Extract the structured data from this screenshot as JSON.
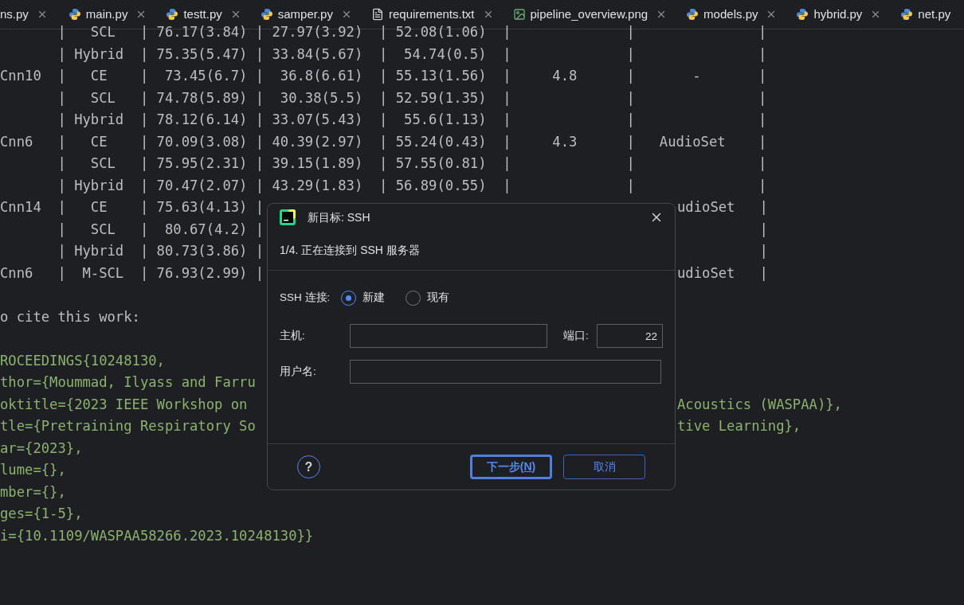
{
  "tabs": [
    {
      "label": "ns.py",
      "kind": "cut",
      "close": true
    },
    {
      "label": "main.py",
      "kind": "python",
      "close": true
    },
    {
      "label": "testt.py",
      "kind": "python",
      "close": true
    },
    {
      "label": "samper.py",
      "kind": "python",
      "close": true
    },
    {
      "label": "requirements.txt",
      "kind": "text",
      "close": true
    },
    {
      "label": "pipeline_overview.png",
      "kind": "image",
      "close": true
    },
    {
      "label": "models.py",
      "kind": "python",
      "close": true
    },
    {
      "label": "hybrid.py",
      "kind": "python",
      "close": true
    },
    {
      "label": "net.py",
      "kind": "python",
      "close": false
    }
  ],
  "editor": {
    "lines": [
      {
        "kind": "plain",
        "left": "       |   SCL   | 76.17(3.84) | 27.97(3.92)  | 52.08(1.06)  |              |               |"
      },
      {
        "kind": "plain",
        "left": "       | Hybrid  | 75.35(5.47) | 33.84(5.67)  |  54.74(0.5)  |              |               |"
      },
      {
        "kind": "plain",
        "left": "Cnn10  |   CE    |  73.45(6.7) |  36.8(6.61)  | 55.13(1.56)  |     4.8      |       -       |"
      },
      {
        "kind": "plain",
        "left": "       |   SCL   | 74.78(5.89) |  30.38(5.5)  | 52.59(1.35)  |              |               |"
      },
      {
        "kind": "plain",
        "left": "       | Hybrid  | 78.12(6.14) | 33.07(5.43)  |  55.6(1.13)  |              |               |"
      },
      {
        "kind": "plain",
        "left": "Cnn6   |   CE    | 70.09(3.08) | 40.39(2.97)  | 55.24(0.43)  |     4.3      |   AudioSet    |"
      },
      {
        "kind": "plain",
        "left": "       |   SCL   | 75.95(2.31) | 39.15(1.89)  | 57.55(0.81)  |              |               |"
      },
      {
        "kind": "plain",
        "left": "       | Hybrid  | 70.47(2.07) | 43.29(1.83)  | 56.89(0.55)  |              |               |"
      },
      {
        "kind": "plain",
        "left": "Cnn14  |   CE    | 75.63(4.13) |",
        "right": "udioSet   |"
      },
      {
        "kind": "plain",
        "left": "       |   SCL   |  80.67(4.2) |",
        "right": "          |"
      },
      {
        "kind": "plain",
        "left": "       | Hybrid  | 80.73(3.86) |",
        "right": "          |"
      },
      {
        "kind": "plain",
        "left": "Cnn6   |  M-SCL  | 76.93(2.99) |",
        "right": "udioSet   |"
      },
      {
        "kind": "plain"
      },
      {
        "kind": "plain",
        "left": "o cite this work:"
      },
      {
        "kind": "plain"
      },
      {
        "kind": "literal",
        "left": "ROCEEDINGS{10248130,"
      },
      {
        "kind": "literal",
        "left": "thor={Moummad, Ilyass and Farru"
      },
      {
        "kind": "literal",
        "left": "oktitle={2023 IEEE Workshop on",
        "right": "Acoustics (WASPAA)},"
      },
      {
        "kind": "literal",
        "left": "tle={Pretraining Respiratory So",
        "right": "tive Learning},"
      },
      {
        "kind": "literal",
        "left": "ar={2023},"
      },
      {
        "kind": "literal",
        "left": "lume={},"
      },
      {
        "kind": "literal",
        "left": "mber={},"
      },
      {
        "kind": "literal",
        "left": "ges={1-5},"
      },
      {
        "kind": "literal",
        "left": "i={10.1109/WASPAA58266.2023.10248130}}"
      }
    ]
  },
  "dialog": {
    "title": "新目标: SSH",
    "step": "1/4. 正在连接到 SSH 服务器",
    "connection": {
      "label": "SSH 连接:",
      "options": [
        {
          "label": "新建",
          "selected": true
        },
        {
          "label": "现有",
          "selected": false
        }
      ]
    },
    "host": {
      "label": "主机:"
    },
    "port": {
      "label": "端口:",
      "value": "22"
    },
    "username": {
      "label": "用户名:"
    },
    "help": "?",
    "buttons": [
      {
        "before": "下一步(",
        "mnemonic": "N",
        "after": ")",
        "default": true
      },
      {
        "before": "取消",
        "default": false
      }
    ]
  }
}
